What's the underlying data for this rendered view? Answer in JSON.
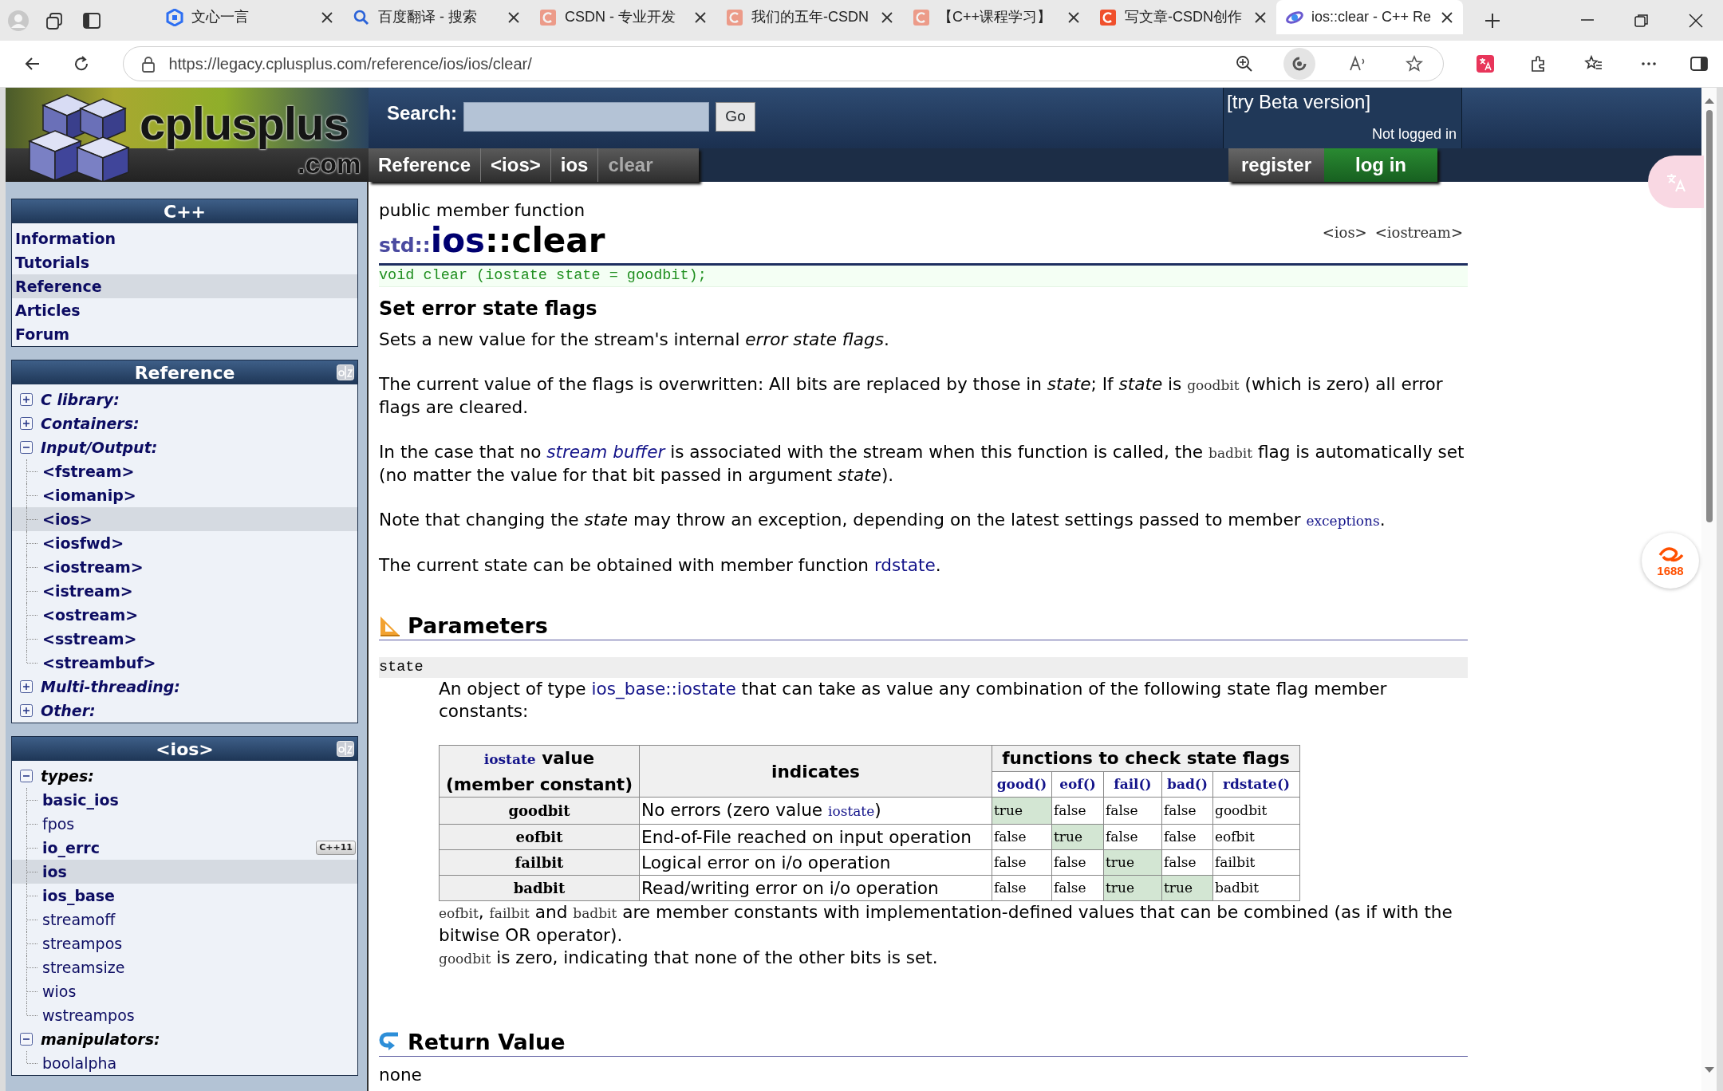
{
  "browser": {
    "tabs": [
      {
        "title": "文心一言",
        "kind": "hex",
        "faded": false,
        "selected": false
      },
      {
        "title": "百度翻译 - 搜索",
        "kind": "search",
        "faded": false,
        "selected": false
      },
      {
        "title": "CSDN - 专业开发",
        "kind": "letter",
        "faded": true,
        "selected": false
      },
      {
        "title": "我们的五年-CSDN",
        "kind": "letter",
        "faded": true,
        "selected": false
      },
      {
        "title": "【C++课程学习】",
        "kind": "letter",
        "faded": true,
        "selected": false
      },
      {
        "title": "写文章-CSDN创作",
        "kind": "letter",
        "faded": false,
        "selected": false
      },
      {
        "title": "ios::clear - C++ Re",
        "kind": "swirl",
        "faded": false,
        "selected": true
      }
    ],
    "url": "https://legacy.cplusplus.com/reference/ios/ios/clear/"
  },
  "header": {
    "logo": {
      "name": "cplusplus",
      "suffix": ".com"
    },
    "search": {
      "label": "Search:",
      "button": "Go"
    },
    "beta_link": "[try Beta version]",
    "login_status": "Not logged in",
    "breadcrumb": [
      {
        "label": "Reference",
        "current": false
      },
      {
        "label": "<ios>",
        "current": false
      },
      {
        "label": "ios",
        "current": false
      },
      {
        "label": "clear",
        "current": true
      }
    ],
    "account": [
      {
        "label": "register",
        "kind": "plain"
      },
      {
        "label": "log in",
        "kind": "primary"
      }
    ]
  },
  "sidebar": [
    {
      "title": "C++",
      "kind": "links",
      "sortable": false,
      "items": [
        {
          "label": "Information",
          "selected": false
        },
        {
          "label": "Tutorials",
          "selected": false
        },
        {
          "label": "Reference",
          "selected": true
        },
        {
          "label": "Articles",
          "selected": false
        },
        {
          "label": "Forum",
          "selected": false
        }
      ]
    },
    {
      "title": "Reference",
      "kind": "tree",
      "sortable": true,
      "items": [
        {
          "label": "C library:",
          "expanded": false
        },
        {
          "label": "Containers:",
          "expanded": false
        },
        {
          "label": "Input/Output:",
          "expanded": true,
          "children": [
            {
              "label": "<fstream>",
              "selected": false
            },
            {
              "label": "<iomanip>",
              "selected": false
            },
            {
              "label": "<ios>",
              "selected": true
            },
            {
              "label": "<iosfwd>",
              "selected": false
            },
            {
              "label": "<iostream>",
              "selected": false
            },
            {
              "label": "<istream>",
              "selected": false
            },
            {
              "label": "<ostream>",
              "selected": false
            },
            {
              "label": "<sstream>",
              "selected": false
            },
            {
              "label": "<streambuf>",
              "selected": false
            }
          ]
        },
        {
          "label": "Multi-threading:",
          "expanded": false
        },
        {
          "label": "Other:",
          "expanded": false
        }
      ]
    },
    {
      "title": "<ios>",
      "kind": "members",
      "sortable": true,
      "items": [
        {
          "label": "types:",
          "expanded": true,
          "children": [
            {
              "label": "basic_ios",
              "bold": true,
              "selected": false
            },
            {
              "label": "fpos",
              "bold": false,
              "selected": false
            },
            {
              "label": "io_errc",
              "bold": true,
              "selected": false,
              "badge": "C++11"
            },
            {
              "label": "ios",
              "bold": true,
              "selected": true
            },
            {
              "label": "ios_base",
              "bold": true,
              "selected": false
            },
            {
              "label": "streamoff",
              "bold": false,
              "selected": false
            },
            {
              "label": "streampos",
              "bold": false,
              "selected": false
            },
            {
              "label": "streamsize",
              "bold": false,
              "selected": false
            },
            {
              "label": "wios",
              "bold": false,
              "selected": false
            },
            {
              "label": "wstreampos",
              "bold": false,
              "selected": false
            }
          ]
        },
        {
          "label": "manipulators:",
          "expanded": true,
          "children": [
            {
              "label": "boolalpha",
              "bold": false,
              "selected": false
            }
          ]
        }
      ]
    }
  ],
  "article": {
    "kind_label": "public member function",
    "scope": "std::",
    "class_name": "ios",
    "member": "::clear",
    "headers": [
      "<ios>",
      "<iostream>"
    ],
    "prototype": "void clear (iostate state = goodbit);",
    "summary": "Set error state flags",
    "paragraphs": [
      [
        {
          "text": "Sets a new value for the stream's internal "
        },
        {
          "text": "error state flags",
          "kind": "italic"
        },
        {
          "text": "."
        }
      ],
      [
        {
          "text": "The current value of the flags is overwritten: All bits are replaced by those in "
        },
        {
          "text": "state",
          "kind": "italic"
        },
        {
          "text": "; If "
        },
        {
          "text": "state",
          "kind": "italic"
        },
        {
          "text": " is "
        },
        {
          "text": "goodbit",
          "kind": "code"
        },
        {
          "text": " (which is zero) all error flags are cleared."
        }
      ],
      [
        {
          "text": "In the case that no "
        },
        {
          "text": "stream buffer",
          "kind": "italic-link"
        },
        {
          "text": " is associated with the stream when this function is called, the "
        },
        {
          "text": "badbit",
          "kind": "code"
        },
        {
          "text": " flag is automatically set (no matter the value for that bit passed in argument "
        },
        {
          "text": "state",
          "kind": "italic"
        },
        {
          "text": ")."
        }
      ],
      [
        {
          "text": "Note that changing the "
        },
        {
          "text": "state",
          "kind": "italic"
        },
        {
          "text": " may throw an exception, depending on the latest settings passed to member "
        },
        {
          "text": "exceptions",
          "kind": "code-link"
        },
        {
          "text": "."
        }
      ],
      [
        {
          "text": "The current state can be obtained with member function "
        },
        {
          "text": "rdstate",
          "kind": "link"
        },
        {
          "text": "."
        }
      ]
    ],
    "parameters": {
      "title": "Parameters",
      "name": "state",
      "description": [
        {
          "text": "An object of type "
        },
        {
          "text": "ios_base::iostate",
          "kind": "link"
        },
        {
          "text": " that can take as value any combination of the following state flag member constants:"
        }
      ],
      "table": {
        "columns": [
          [
            {
              "text": "iostate",
              "kind": "code-link"
            },
            {
              "text": " value (member constant)"
            }
          ],
          [
            {
              "text": "indicates"
            }
          ]
        ],
        "group": "functions to check state flags",
        "functions": [
          "good()",
          "eof()",
          "fail()",
          "bad()",
          "rdstate()"
        ],
        "rows": [
          {
            "constant": "goodbit",
            "indicates": [
              {
                "text": "No errors (zero value "
              },
              {
                "text": "iostate",
                "kind": "code-link"
              },
              {
                "text": ")"
              }
            ],
            "results": [
              {
                "text": "true",
                "highlight": true
              },
              {
                "text": "false",
                "highlight": false
              },
              {
                "text": "false",
                "highlight": false
              },
              {
                "text": "false",
                "highlight": false
              },
              {
                "text": "goodbit",
                "highlight": false
              }
            ]
          },
          {
            "constant": "eofbit",
            "indicates": [
              {
                "text": "End-of-File reached on input operation"
              }
            ],
            "results": [
              {
                "text": "false",
                "highlight": false
              },
              {
                "text": "true",
                "highlight": true
              },
              {
                "text": "false",
                "highlight": false
              },
              {
                "text": "false",
                "highlight": false
              },
              {
                "text": "eofbit",
                "highlight": false
              }
            ]
          },
          {
            "constant": "failbit",
            "indicates": [
              {
                "text": "Logical error on i/o operation"
              }
            ],
            "results": [
              {
                "text": "false",
                "highlight": false
              },
              {
                "text": "false",
                "highlight": false
              },
              {
                "text": "true",
                "highlight": true
              },
              {
                "text": "false",
                "highlight": false
              },
              {
                "text": "failbit",
                "highlight": false
              }
            ]
          },
          {
            "constant": "badbit",
            "indicates": [
              {
                "text": "Read/writing error on i/o operation"
              }
            ],
            "results": [
              {
                "text": "false",
                "highlight": false
              },
              {
                "text": "false",
                "highlight": false
              },
              {
                "text": "true",
                "highlight": true
              },
              {
                "text": "true",
                "highlight": true
              },
              {
                "text": "badbit",
                "highlight": false
              }
            ]
          }
        ]
      },
      "notes": [
        [
          {
            "text": "eofbit",
            "kind": "code"
          },
          {
            "text": ", "
          },
          {
            "text": "failbit",
            "kind": "code"
          },
          {
            "text": " and "
          },
          {
            "text": "badbit",
            "kind": "code"
          },
          {
            "text": " are member constants with implementation-defined values that can be combined (as if with the bitwise OR operator)."
          }
        ],
        [
          {
            "text": "goodbit",
            "kind": "code"
          },
          {
            "text": " is zero, indicating that none of the other bits is set."
          }
        ]
      ]
    },
    "return_value": {
      "title": "Return Value",
      "text": "none"
    }
  },
  "floating_buttons": [
    {
      "kind": "translate"
    },
    {
      "kind": "shop",
      "label": "1688"
    }
  ]
}
